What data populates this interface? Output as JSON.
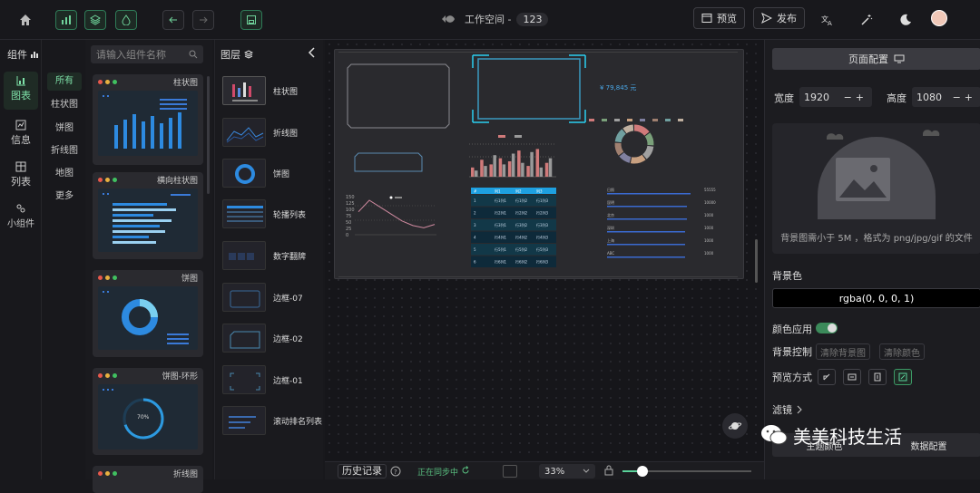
{
  "topbar": {
    "workspace_label": "工作空间 -",
    "workspace_id": "123",
    "preview_label": "预览",
    "publish_label": "发布"
  },
  "components": {
    "header_label": "组件",
    "search_placeholder": "请输入组件名称"
  },
  "nav": {
    "items": [
      {
        "label": "图表"
      },
      {
        "label": "信息"
      },
      {
        "label": "列表"
      },
      {
        "label": "小组件"
      }
    ]
  },
  "subnav": {
    "items": [
      "所有",
      "柱状图",
      "饼图",
      "折线图",
      "地图",
      "更多"
    ]
  },
  "cards": [
    {
      "title": "柱状图"
    },
    {
      "title": "横向柱状图"
    },
    {
      "title": "饼图"
    },
    {
      "title": "饼图-环形",
      "value": "70%"
    },
    {
      "title": "折线图"
    }
  ],
  "layers": {
    "header_label": "图层",
    "items": [
      "柱状图",
      "折线图",
      "饼图",
      "轮播列表",
      "数字翻牌",
      "边框-07",
      "边框-02",
      "边框-01",
      "滚动排名列表"
    ]
  },
  "canvas": {
    "number": "¥ 79,845 元",
    "bar_chart": {
      "type": "bar",
      "series": [
        {
          "values": [
            30,
            55,
            40,
            60,
            50,
            85,
            35,
            90,
            45
          ]
        },
        {
          "values": [
            20,
            35,
            70,
            40,
            75,
            45,
            80,
            30,
            60
          ]
        }
      ]
    },
    "line_chart": {
      "type": "line",
      "values": [
        100,
        150,
        120,
        90,
        60,
        40,
        30,
        45
      ],
      "yticks": [
        "150",
        "125",
        "100",
        "75",
        "50",
        "25",
        "0"
      ]
    },
    "pie_chart": {
      "type": "pie",
      "values": [
        15,
        12,
        13,
        14,
        11,
        12,
        13,
        10
      ],
      "colors": [
        "#d07a7a",
        "#7aa07a",
        "#a0a0a0",
        "#c8a080",
        "#8080a0",
        "#a08070",
        "#70a0a0",
        "#c0b0a0"
      ]
    },
    "table": {
      "header": [
        "#",
        "列1",
        "列2",
        "列3"
      ],
      "rows": [
        [
          "1",
          "行1列1",
          "行1列2",
          "行1列3"
        ],
        [
          "2",
          "行2列1",
          "行2列2",
          "行2列3"
        ],
        [
          "3",
          "行3列1",
          "行3列2",
          "行3列3"
        ],
        [
          "4",
          "行4列1",
          "行4列2",
          "行4列3"
        ],
        [
          "5",
          "行5列1",
          "行5列2",
          "行5列3"
        ],
        [
          "6",
          "行6列1",
          "行6列2",
          "行6列3"
        ]
      ]
    },
    "ranking": [
      {
        "label": "日照",
        "value": "55555"
      },
      {
        "label": "昆明",
        "value": "10000"
      },
      {
        "label": "北京",
        "value": "1000"
      },
      {
        "label": "深圳",
        "value": "1000"
      },
      {
        "label": "上海",
        "value": "1000"
      },
      {
        "label": "ABC",
        "value": "1000"
      }
    ]
  },
  "bottom": {
    "history_label": "历史记录",
    "sync_label": "正在同步中",
    "zoom": "33%"
  },
  "right": {
    "page_config_label": "页面配置",
    "width_label": "宽度",
    "width_value": "1920",
    "height_label": "高度",
    "height_value": "1080",
    "bg_hint": "背景图需小于 5M ，格式为 png/jpg/gif 的文件",
    "bg_color_label": "背景色",
    "bg_color_value": "rgba(0, 0, 0, 1)",
    "color_apply_label": "颜色应用",
    "bg_control_label": "背景控制",
    "clear_bg_image": "清除背景图",
    "clear_color": "清除颜色",
    "preview_mode_label": "预览方式",
    "filter_label": "滤镜",
    "theme_label": "主题颜色",
    "data_config_label": "数据配置"
  },
  "watermark": {
    "text": "美美科技生活"
  }
}
